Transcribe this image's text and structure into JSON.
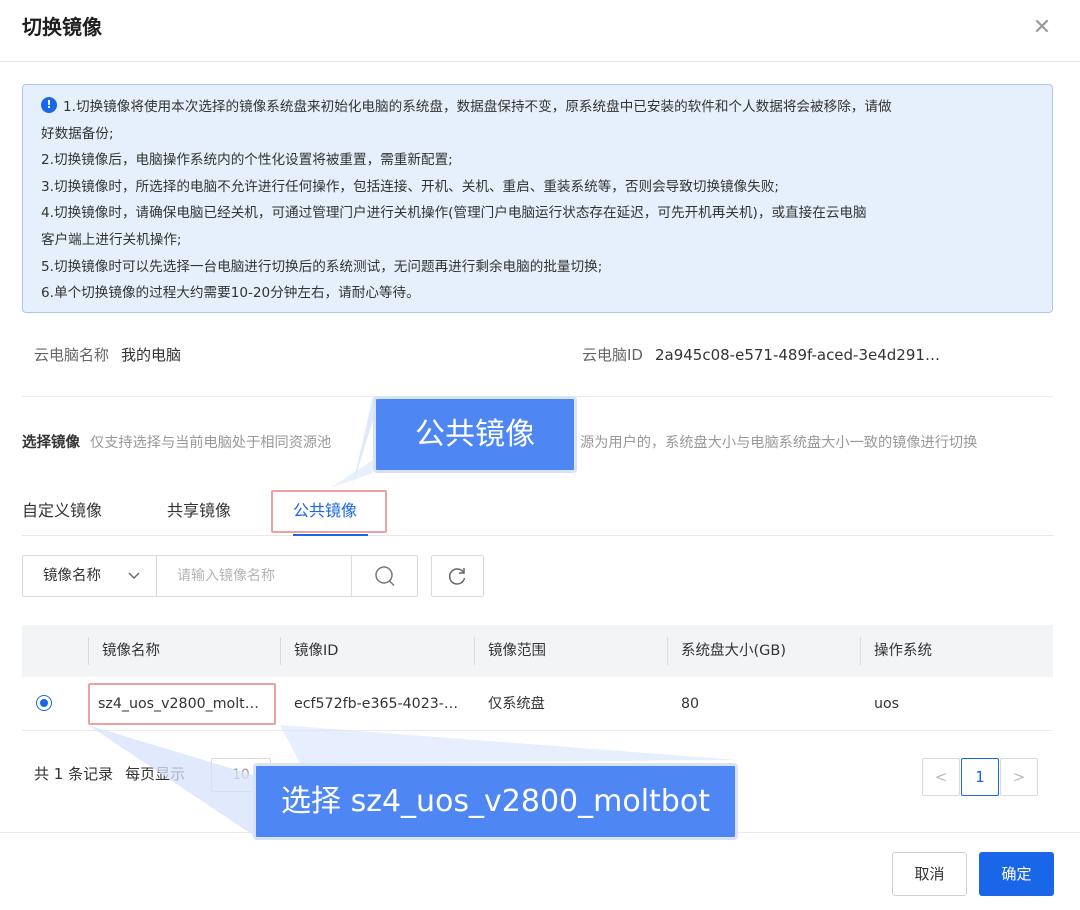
{
  "dialog": {
    "title": "切换镜像",
    "close_icon": "close-icon"
  },
  "notice": {
    "icon": "info-icon",
    "icon_glyph": "!",
    "lines": [
      "1.切换镜像将使用本次选择的镜像系统盘来初始化电脑的系统盘，数据盘保持不变，原系统盘中已安装的软件和个人数据将会被移除，请做",
      "好数据备份;",
      "2.切换镜像后，电脑操作系统内的个性化设置将被重置，需重新配置;",
      "3.切换镜像时，所选择的电脑不允许进行任何操作，包括连接、开机、关机、重启、重装系统等，否则会导致切换镜像失败;",
      "4.切换镜像时，请确保电脑已经关机，可通过管理门户进行关机操作(管理门户电脑运行状态存在延迟，可先开机再关机)，或直接在云电脑",
      "客户端上进行关机操作;",
      "5.切换镜像时可以先选择一台电脑进行切换后的系统测试，无问题再进行剩余电脑的批量切换;",
      "6.单个切换镜像的过程大约需要10-20分钟左右，请耐心等待。"
    ]
  },
  "computer": {
    "name_label": "云电脑名称",
    "name_value": "我的电脑",
    "id_label": "云电脑ID",
    "id_value": "2a945c08-e571-489f-aced-3e4d291…"
  },
  "select_image": {
    "label": "选择镜像",
    "desc_head": "仅支持选择与当前电脑处于相同资源池",
    "desc_tail": "源为用户的，系统盘大小与电脑系统盘大小一致的镜像进行切换"
  },
  "tabs": [
    {
      "label": "自定义镜像",
      "active": false
    },
    {
      "label": "共享镜像",
      "active": false
    },
    {
      "label": "公共镜像",
      "active": true
    }
  ],
  "search": {
    "type_label": "镜像名称",
    "type_icon": "chevron-down-icon",
    "placeholder": "请输入镜像名称",
    "search_icon": "search-icon",
    "refresh_icon": "refresh-icon"
  },
  "table": {
    "columns": [
      "镜像名称",
      "镜像ID",
      "镜像范围",
      "系统盘大小(GB)",
      "操作系统"
    ],
    "rows": [
      {
        "selected": true,
        "name": "sz4_uos_v2800_molt…",
        "id": "ecf572fb-e365-4023-…",
        "scope": "仅系统盘",
        "disk": "80",
        "os": "uos"
      }
    ]
  },
  "pagination": {
    "total_text": "共 1 条记录",
    "page_size_label": "每页显示",
    "page_size": "10",
    "prev": "<",
    "current": "1",
    "next": ">"
  },
  "footer": {
    "cancel": "取消",
    "ok": "确定"
  },
  "callouts": {
    "tab": "公共镜像",
    "row": "选择 sz4_uos_v2800_moltbot"
  },
  "colors": {
    "accent": "#1a66e8",
    "notice_bg": "#e6f0fd",
    "callout_bg": "#4e86f4",
    "highlight_border": "#f0a0a0"
  }
}
